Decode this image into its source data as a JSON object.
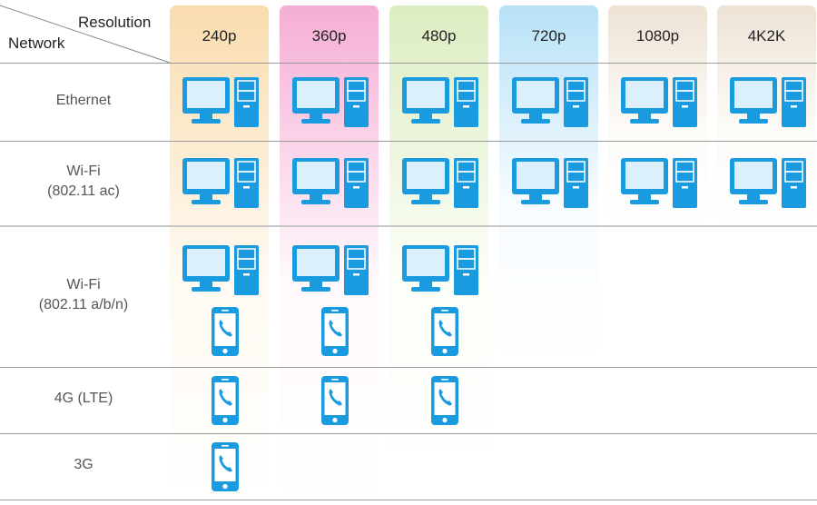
{
  "header": {
    "resolution_label": "Resolution",
    "network_label": "Network"
  },
  "columns": [
    {
      "label": "240p",
      "color_top": "#f9dcae",
      "color_bottom": "#fffaf2"
    },
    {
      "label": "360p",
      "color_top": "#f5aed5",
      "color_bottom": "#fff8fc"
    },
    {
      "label": "480p",
      "color_top": "#dcedc2",
      "color_bottom": "#fcfef8"
    },
    {
      "label": "720p",
      "color_top": "#b7e1f7",
      "color_bottom": "#f8fcff"
    },
    {
      "label": "1080p",
      "color_top": "#ede3d5",
      "color_bottom": "#fdfbf8"
    },
    {
      "label": "4K2K",
      "color_top": "#ede3d5",
      "color_bottom": "#fdfbf8"
    }
  ],
  "rows": [
    {
      "label_line1": "Ethernet",
      "label_line2": "",
      "pc": [
        true,
        true,
        true,
        true,
        true,
        true
      ],
      "phone": [
        false,
        false,
        false,
        false,
        false,
        false
      ]
    },
    {
      "label_line1": "Wi-Fi",
      "label_line2": "(802.11 ac)",
      "pc": [
        true,
        true,
        true,
        true,
        true,
        true
      ],
      "phone": [
        false,
        false,
        false,
        false,
        false,
        false
      ]
    },
    {
      "label_line1": "Wi-Fi",
      "label_line2": "(802.11 a/b/n)",
      "pc": [
        true,
        true,
        true,
        false,
        false,
        false
      ],
      "phone": [
        true,
        true,
        true,
        false,
        false,
        false
      ]
    },
    {
      "label_line1": "4G (LTE)",
      "label_line2": "",
      "pc": [
        false,
        false,
        false,
        false,
        false,
        false
      ],
      "phone": [
        true,
        true,
        true,
        false,
        false,
        false
      ]
    },
    {
      "label_line1": "3G",
      "label_line2": "",
      "pc": [
        false,
        false,
        false,
        false,
        false,
        false
      ],
      "phone": [
        true,
        false,
        false,
        false,
        false,
        false
      ]
    }
  ],
  "icons": {
    "pc": "desktop-computer-icon",
    "phone": "smartphone-call-icon",
    "color": "#1a9be0"
  }
}
